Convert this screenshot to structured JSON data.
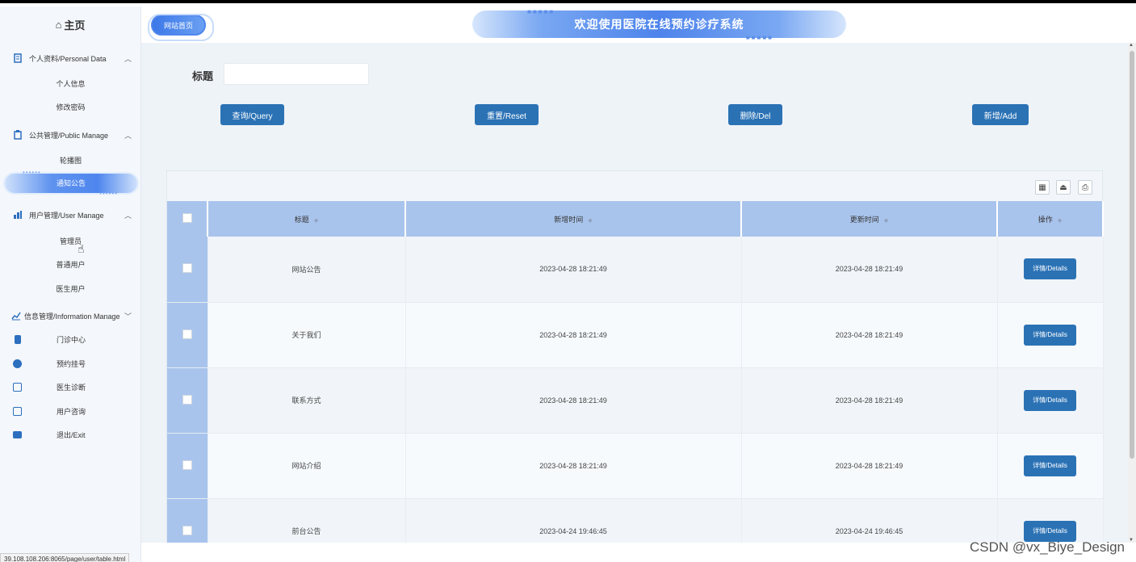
{
  "sidebar": {
    "home_label": "主页",
    "groups": [
      {
        "label": "个人资料/Personal Data"
      },
      {
        "label": "公共管理/Public Manage"
      },
      {
        "label": "用户管理/User Manage"
      },
      {
        "label": "信息管理/Information Manage"
      }
    ],
    "subs": [
      "个人信息",
      "修改密码",
      "轮播图",
      "通知公告",
      "管理员",
      "普通用户",
      "医生用户"
    ],
    "items": [
      "门诊中心",
      "预约挂号",
      "医生诊断",
      "用户咨询",
      "退出/Exit"
    ]
  },
  "header": {
    "site_home": "网站首页",
    "banner_title": "欢迎使用医院在线预约诊疗系统"
  },
  "search": {
    "label": "标题",
    "value": ""
  },
  "buttons": {
    "query": "查询/Query",
    "reset": "重置/Reset",
    "delete": "删除/Del",
    "add": "新增/Add"
  },
  "table": {
    "columns": [
      "标题",
      "新增时间",
      "更新时间",
      "操作"
    ],
    "rows": [
      {
        "title": "网站公告",
        "created": "2023-04-28 18:21:49",
        "updated": "2023-04-28 18:21:49",
        "action": "详情/Details"
      },
      {
        "title": "关于我们",
        "created": "2023-04-28 18:21:49",
        "updated": "2023-04-28 18:21:49",
        "action": "详情/Details"
      },
      {
        "title": "联系方式",
        "created": "2023-04-28 18:21:49",
        "updated": "2023-04-28 18:21:49",
        "action": "详情/Details"
      },
      {
        "title": "网站介绍",
        "created": "2023-04-28 18:21:49",
        "updated": "2023-04-28 18:21:49",
        "action": "详情/Details"
      },
      {
        "title": "前台公告",
        "created": "2023-04-24 19:46:45",
        "updated": "2023-04-24 19:46:45",
        "action": "详情/Details"
      }
    ]
  },
  "status_url": "39.108.108.206:8065/page/user/table.html",
  "watermark": "CSDN @vx_Biye_Design",
  "colors": {
    "accent": "#2b72b5",
    "header_row": "#a9c4ec",
    "sidebar_bg": "#f4f7fb"
  }
}
